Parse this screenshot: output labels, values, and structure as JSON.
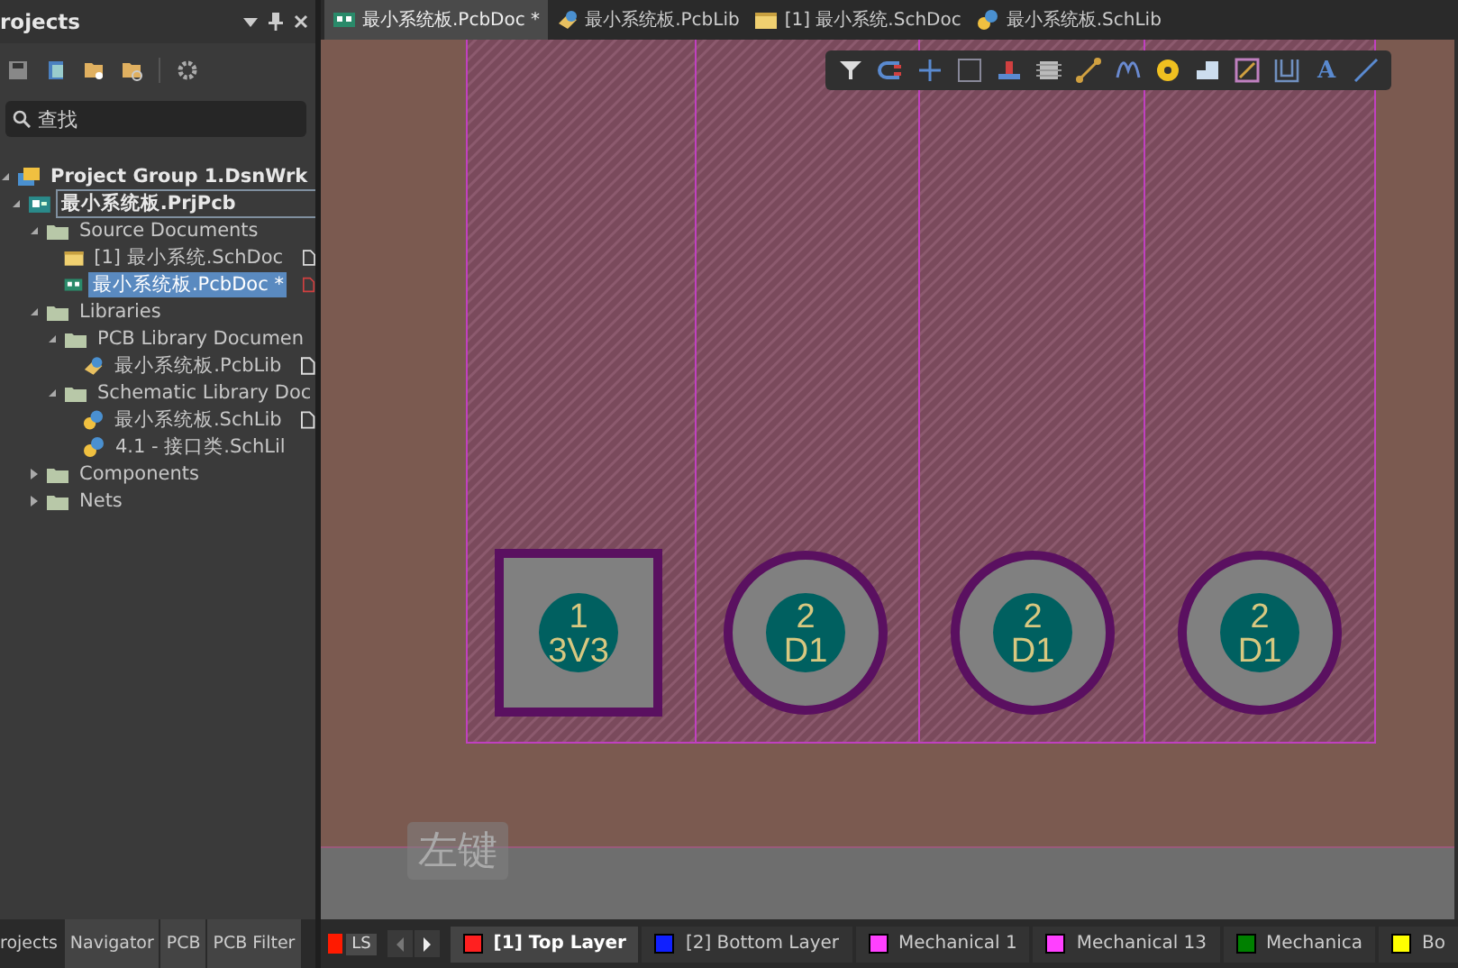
{
  "panel": {
    "title": "rojects",
    "search": {
      "placeholder": "查找"
    },
    "tree": [
      {
        "label": "Project Group 1.DsnWrk",
        "kind": "group",
        "expanded": true,
        "selected": false,
        "children": [
          {
            "label": "最小系统板.PrjPcb",
            "kind": "project",
            "expanded": true,
            "selected": false,
            "children": [
              {
                "label": "Source Documents",
                "kind": "folder",
                "expanded": true,
                "selected": false,
                "children": [
                  {
                    "label": "[1] 最小系统.SchDoc",
                    "kind": "schdoc",
                    "modified": false,
                    "selected": false
                  },
                  {
                    "label": "最小系统板.PcbDoc *",
                    "kind": "pcbdoc",
                    "modified": true,
                    "selected": true
                  }
                ]
              },
              {
                "label": "Libraries",
                "kind": "folder",
                "expanded": true,
                "selected": false,
                "children": [
                  {
                    "label": "PCB Library Documen",
                    "kind": "folder",
                    "expanded": true,
                    "selected": false,
                    "children": [
                      {
                        "label": "最小系统板.PcbLib",
                        "kind": "pcblib",
                        "modified": false,
                        "selected": false
                      }
                    ]
                  },
                  {
                    "label": "Schematic Library Doc",
                    "kind": "folder",
                    "expanded": true,
                    "selected": false,
                    "children": [
                      {
                        "label": "最小系统板.SchLib",
                        "kind": "schlib",
                        "modified": false,
                        "selected": false
                      },
                      {
                        "label": "4.1    - 接口类.SchLil",
                        "kind": "schlib",
                        "selected": false
                      }
                    ]
                  }
                ]
              },
              {
                "label": "Components",
                "kind": "folder",
                "expanded": false,
                "selected": false
              },
              {
                "label": "Nets",
                "kind": "folder",
                "expanded": false,
                "selected": false
              }
            ]
          }
        ]
      }
    ],
    "panel_tabs": [
      {
        "label": "rojects",
        "selected": true
      },
      {
        "label": "Navigator",
        "selected": false
      },
      {
        "label": "PCB",
        "selected": false
      },
      {
        "label": "PCB Filter",
        "selected": false
      }
    ]
  },
  "doc_tabs": [
    {
      "label": "最小系统板.PcbDoc *",
      "kind": "pcbdoc",
      "selected": true
    },
    {
      "label": "最小系统板.PcbLib",
      "kind": "pcblib",
      "selected": false
    },
    {
      "label": "[1] 最小系统.SchDoc",
      "kind": "schdoc",
      "selected": false
    },
    {
      "label": "最小系统板.SchLib",
      "kind": "schlib",
      "selected": false
    }
  ],
  "toolbar": [
    {
      "kind": "filter"
    },
    {
      "kind": "magnet"
    },
    {
      "kind": "cross"
    },
    {
      "kind": "rect"
    },
    {
      "kind": "place"
    },
    {
      "kind": "chip"
    },
    {
      "kind": "route"
    },
    {
      "kind": "wave"
    },
    {
      "kind": "via"
    },
    {
      "kind": "fill"
    },
    {
      "kind": "polygon"
    },
    {
      "kind": "room"
    },
    {
      "kind": "text",
      "glyph": "A"
    },
    {
      "kind": "line"
    }
  ],
  "pads": [
    {
      "kind": "square",
      "number": "1",
      "net": "3V3"
    },
    {
      "kind": "round",
      "number": "2",
      "net": "D1"
    },
    {
      "kind": "round",
      "number": "2",
      "net": "D1"
    },
    {
      "kind": "round",
      "number": "2",
      "net": "D1"
    }
  ],
  "key_hint": "左键",
  "current_layer": {
    "label": "LS"
  },
  "layers": [
    {
      "label": "[1] Top Layer",
      "color": "#ff2020",
      "selected": true
    },
    {
      "label": "[2] Bottom Layer",
      "color": "#1020ff",
      "selected": false
    },
    {
      "label": "Mechanical 1",
      "color": "#ff40ff",
      "selected": false
    },
    {
      "label": "Mechanical 13",
      "color": "#ff40ff",
      "selected": false
    },
    {
      "label": "Mechanica",
      "color": "#008000",
      "selected": false
    },
    {
      "label": "Bo",
      "color": "#ffff00",
      "selected": false
    }
  ]
}
